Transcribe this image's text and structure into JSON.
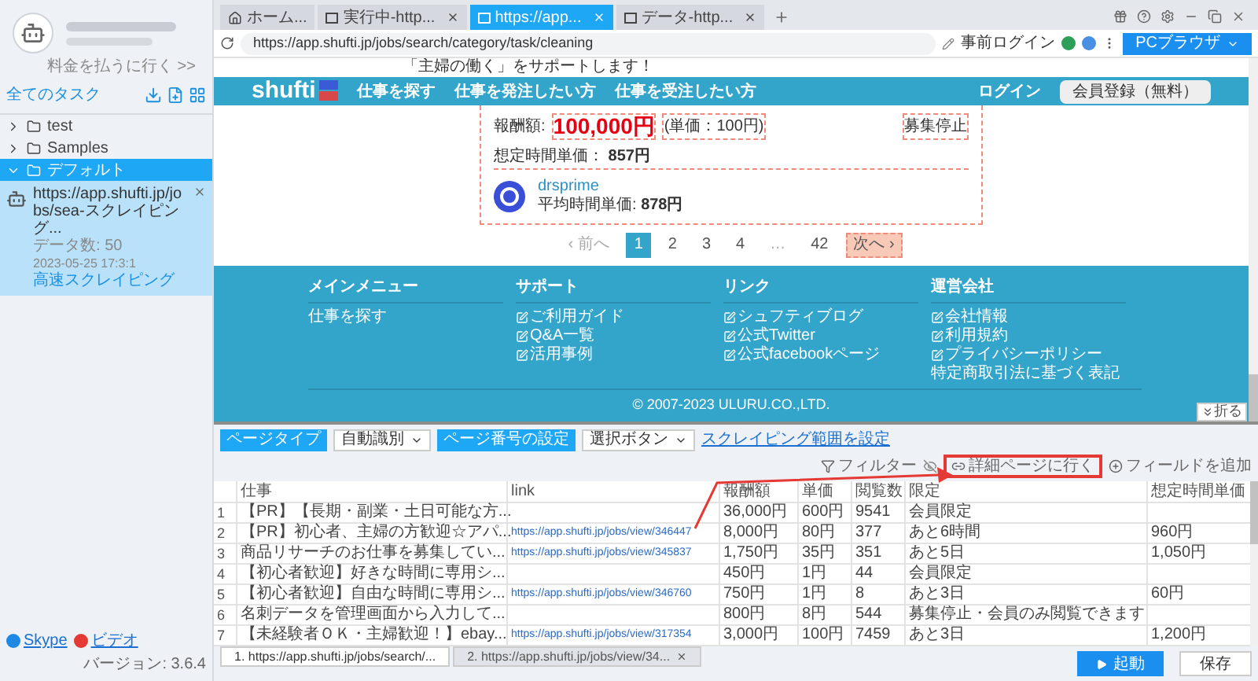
{
  "sidebar": {
    "upgrade_link": "料金を払うに行く >>",
    "all_tasks_label": "全てのタスク",
    "folders": [
      {
        "name": "test",
        "expanded": false,
        "selected": false
      },
      {
        "name": "Samples",
        "expanded": false,
        "selected": false
      },
      {
        "name": "デフォルト",
        "expanded": true,
        "selected": true,
        "tasks": [
          {
            "url": "https://app.shufti.jp/jobs/sea-スクレイピング...",
            "data_count_label": "データ数:",
            "data_count": "50",
            "date": "2023-05-25 17:3:1",
            "mode": "高速スクレイピング"
          }
        ]
      }
    ],
    "footer_links": [
      "Skype",
      "ビデオ"
    ],
    "version": "バージョン: 3.6.4"
  },
  "browser_tabs": [
    {
      "label": "ホーム...",
      "kind": "home",
      "selected": false
    },
    {
      "label": "実行中-http...",
      "kind": "page",
      "selected": false
    },
    {
      "label": "https://app...",
      "kind": "page",
      "selected": true
    },
    {
      "label": "データ-http...",
      "kind": "page",
      "selected": false
    }
  ],
  "address_bar": {
    "url": "https://app.shufti.jp/jobs/search/category/task/cleaning",
    "prelogin": "事前ログイン",
    "browser_mode": "PCブラウザ"
  },
  "webpage": {
    "tagline": "「主婦の働く」をサポートします！",
    "logo": "shufti",
    "nav": [
      "仕事を探す",
      "仕事を発注したい方",
      "仕事を受注したい方"
    ],
    "login": "ログイン",
    "signup": "会員登録（無料）",
    "job": {
      "reward_label": "報酬額:",
      "reward": "100,000円",
      "unit_price": "(単価：100円)",
      "status": "募集停止",
      "hourly_label": "想定時間単価：",
      "hourly": "857円",
      "client": "drsprime",
      "client_hourly_label": "平均時間単価:",
      "client_hourly": "878円"
    },
    "pagination": [
      {
        "label": "‹ 前へ",
        "kind": "prev",
        "selected": false,
        "highlighted": false
      },
      {
        "label": "1",
        "kind": "page",
        "selected": true,
        "highlighted": false
      },
      {
        "label": "2",
        "kind": "page",
        "selected": false,
        "highlighted": false
      },
      {
        "label": "3",
        "kind": "page",
        "selected": false,
        "highlighted": false
      },
      {
        "label": "4",
        "kind": "page",
        "selected": false,
        "highlighted": false
      },
      {
        "label": "…",
        "kind": "gap",
        "selected": false,
        "highlighted": false
      },
      {
        "label": "42",
        "kind": "page",
        "selected": false,
        "highlighted": false
      },
      {
        "label": "次へ ›",
        "kind": "next",
        "selected": false,
        "highlighted": true
      }
    ],
    "footer_columns": [
      {
        "heading": "メインメニュー",
        "links": [
          {
            "label": "仕事を探す",
            "external": false
          }
        ]
      },
      {
        "heading": "サポート",
        "links": [
          {
            "label": "ご利用ガイド",
            "external": true
          },
          {
            "label": "Q&A一覧",
            "external": true
          },
          {
            "label": "活用事例",
            "external": true
          }
        ]
      },
      {
        "heading": "リンク",
        "links": [
          {
            "label": "シュフティブログ",
            "external": true
          },
          {
            "label": "公式Twitter",
            "external": true
          },
          {
            "label": "公式facebookページ",
            "external": true
          }
        ]
      },
      {
        "heading": "運営会社",
        "links": [
          {
            "label": "会社情報",
            "external": true
          },
          {
            "label": "利用規約",
            "external": true
          },
          {
            "label": "プライバシーポリシー",
            "external": true
          },
          {
            "label": "特定商取引法に基づく表記",
            "external": false
          }
        ]
      }
    ],
    "copyright": "© 2007-2023 ULURU.CO.,LTD."
  },
  "fold_button": "折る",
  "toolbar": {
    "page_type_label": "ページタイプ",
    "page_type_value": "自動識別",
    "page_number_label": "ページ番号の設定",
    "page_number_value": "選択ボタン",
    "range_link": "スクレイピング範囲を設定",
    "filter": "フィルター",
    "detail": "詳細ページに行く",
    "add_field": "フィールドを追加"
  },
  "table": {
    "columns": [
      {
        "label": "仕事",
        "kind": "text"
      },
      {
        "label": "link",
        "kind": "link"
      },
      {
        "label": "報酬額",
        "kind": "text"
      },
      {
        "label": "単価",
        "kind": "text"
      },
      {
        "label": "閲覧数",
        "kind": "text"
      },
      {
        "label": "限定",
        "kind": "text"
      },
      {
        "label": "想定時間単価",
        "kind": "text"
      }
    ],
    "rows": [
      {
        "number": "1",
        "cells": [
          "【PR】【長期・副業・土日可能な方...",
          null,
          "36,000円",
          "600円",
          "9541",
          "会員限定",
          null
        ]
      },
      {
        "number": "2",
        "cells": [
          "【PR】初心者、主婦の方歓迎☆アパ...",
          "https://app.shufti.jp/jobs/view/346447",
          "8,000円",
          "80円",
          "377",
          "あと6時間",
          "960円"
        ]
      },
      {
        "number": "3",
        "cells": [
          "商品リサーチのお仕事を募集してい...",
          "https://app.shufti.jp/jobs/view/345837",
          "1,750円",
          "35円",
          "351",
          "あと5日",
          "1,050円"
        ]
      },
      {
        "number": "4",
        "cells": [
          "【初心者歓迎】好きな時間に専用シ...",
          null,
          "450円",
          "1円",
          "44",
          "会員限定",
          null
        ]
      },
      {
        "number": "5",
        "cells": [
          "【初心者歓迎】自由な時間に専用シ...",
          "https://app.shufti.jp/jobs/view/346760",
          "750円",
          "1円",
          "8",
          "あと3日",
          "60円"
        ]
      },
      {
        "number": "6",
        "cells": [
          "名刺データを管理画面から入力して...",
          null,
          "800円",
          "8円",
          "544",
          "募集停止・会員のみ閲覧できます",
          null
        ]
      },
      {
        "number": "7",
        "cells": [
          "【未経験者ＯＫ・主婦歓迎！】ebay...",
          "https://app.shufti.jp/jobs/view/317354",
          "3,000円",
          "100円",
          "7459",
          "あと3日",
          "1,200円"
        ]
      }
    ]
  },
  "bottom_tabs": [
    {
      "label": "1. https://app.shufti.jp/jobs/search/...",
      "selected": true
    },
    {
      "label": "2. https://app.shufti.jp/jobs/view/34...",
      "selected": false
    }
  ],
  "actions": {
    "run": "起動",
    "save": "保存"
  }
}
